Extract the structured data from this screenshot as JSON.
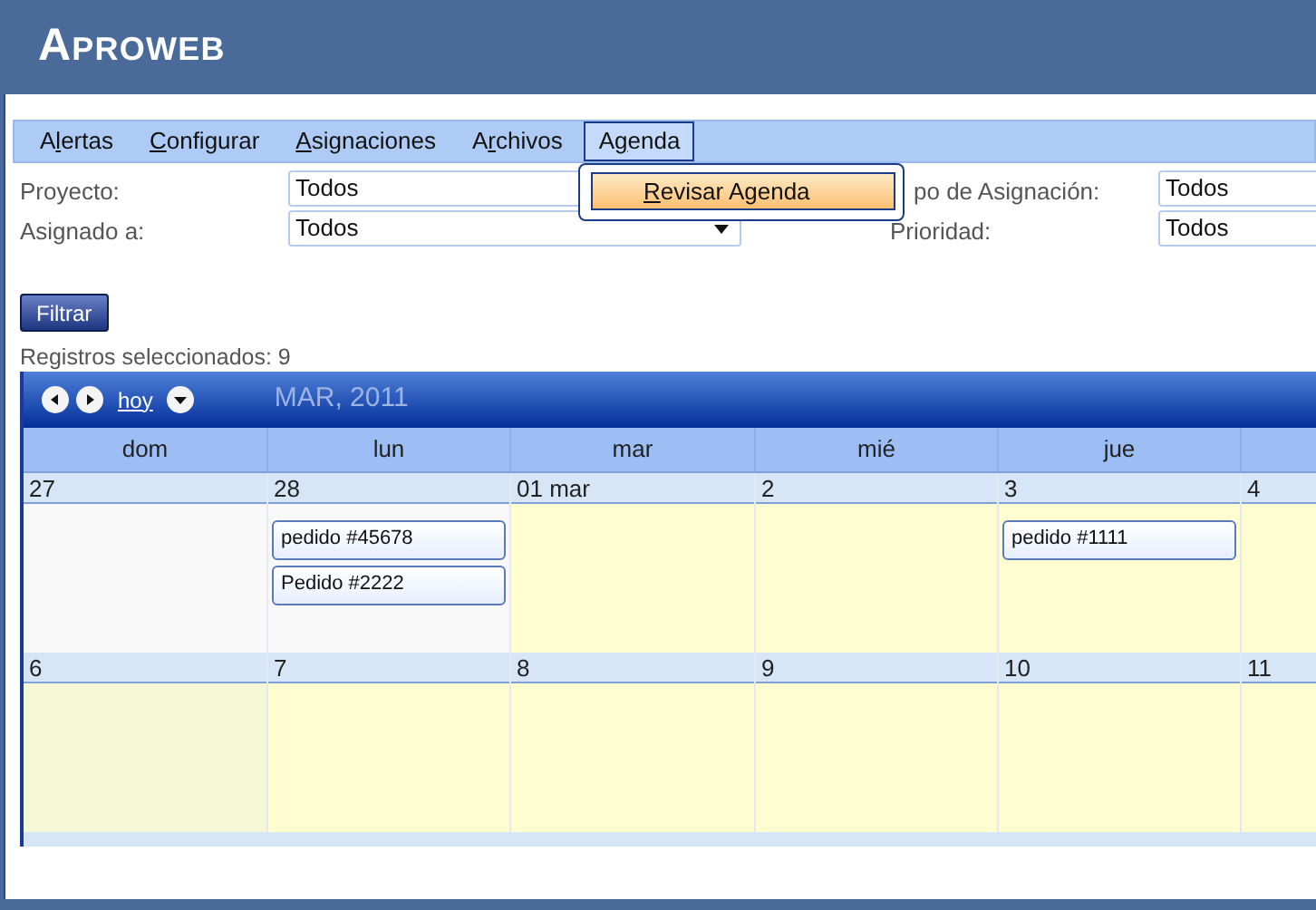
{
  "app_title": "Aproweb",
  "menu": [
    {
      "pre": "A",
      "key": "l",
      "post": "ertas",
      "selected": false
    },
    {
      "key": "C",
      "post": "onfigurar",
      "selected": false
    },
    {
      "key": "A",
      "post": "signaciones",
      "selected": false
    },
    {
      "pre": "A",
      "key": "r",
      "post": "chivos",
      "selected": false
    },
    {
      "pre": "A",
      "key": "g",
      "post": "enda",
      "selected": true
    }
  ],
  "dropdown": [
    {
      "key": "R",
      "post": "evisar Agenda",
      "selected": true
    }
  ],
  "filters": [
    {
      "label": "Proyecto:",
      "value": "Todos"
    },
    {
      "label": "po de Asignación:",
      "value": "Todos"
    },
    {
      "label": "Asignado a:",
      "value": "Todos",
      "arrow": true
    },
    {
      "label": "Prioridad:",
      "value": "Todos"
    }
  ],
  "filter_button": "Filtrar",
  "records": "Registros seleccionados: 9",
  "calendar": {
    "today_link": "hoy",
    "month": "MAR, 2011",
    "days": [
      "dom",
      "lun",
      "mar",
      "mié",
      "jue"
    ],
    "weeks": [
      {
        "cells": [
          {
            "date": "27",
            "kind": "past"
          },
          {
            "date": "28",
            "kind": "past",
            "events": [
              "pedido #45678",
              "Pedido #2222"
            ]
          },
          {
            "date": "01 mar",
            "kind": "normal"
          },
          {
            "date": "2",
            "kind": "normal"
          },
          {
            "date": "3",
            "kind": "normal",
            "events": [
              "pedido #1111"
            ]
          },
          {
            "date": "4",
            "kind": "normal"
          }
        ]
      },
      {
        "cells": [
          {
            "date": "6",
            "kind": "today"
          },
          {
            "date": "7",
            "kind": "normal"
          },
          {
            "date": "8",
            "kind": "normal"
          },
          {
            "date": "9",
            "kind": "normal"
          },
          {
            "date": "10",
            "kind": "normal"
          },
          {
            "date": "11",
            "kind": "normal"
          }
        ]
      }
    ]
  }
}
